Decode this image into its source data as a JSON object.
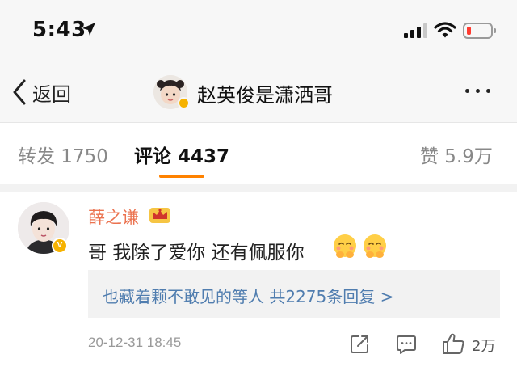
{
  "status_bar": {
    "time": "5:43",
    "battery_color": "#ff3b30"
  },
  "nav": {
    "back_label": "返回",
    "title": "赵英俊是潇洒哥"
  },
  "tabs": {
    "repost": "转发 1750",
    "comments": "评论 4437",
    "likes": "赞 5.9万",
    "active_color": "#ff8200"
  },
  "comment": {
    "username": "薛之谦",
    "badge_letter": "V",
    "text": "哥 我除了爱你 还有佩服你",
    "replies_preview": "也藏着颗不敢见的等人  共2275条回复 >",
    "timestamp": "20-12-31 18:45",
    "like_count": "2万",
    "name_color": "#eb7350",
    "link_color": "#507daf"
  }
}
